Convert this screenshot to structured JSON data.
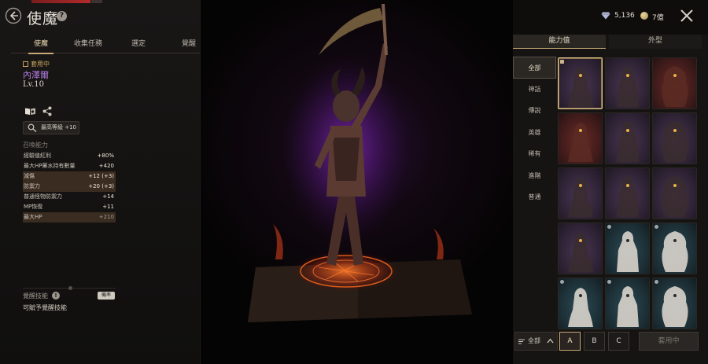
{
  "header": {
    "title": "使魔",
    "help": "?"
  },
  "tabs": [
    {
      "label": "使魔",
      "active": true
    },
    {
      "label": "收集任務",
      "active": false
    },
    {
      "label": "選定",
      "active": false
    },
    {
      "label": "覺醒",
      "active": false
    }
  ],
  "familiar": {
    "status_badge": "套用中",
    "name": "內澤爾",
    "level": "Lv.10",
    "max_level_button": "最高等級 +10",
    "summon_effect_label": "召喚能力",
    "stats": [
      {
        "label": "經驗值紅利",
        "value": "+80%",
        "highlight": false
      },
      {
        "label": "最大HP藥水持有數量",
        "value": "+420",
        "highlight": false
      },
      {
        "label": "減傷",
        "value": "+12 (+3)",
        "highlight": true
      },
      {
        "label": "防禦力",
        "value": "+20 (+3)",
        "highlight": true
      },
      {
        "label": "普通怪物防禦力",
        "value": "+14",
        "highlight": false
      },
      {
        "label": "MP恢復",
        "value": "+11",
        "highlight": false
      },
      {
        "label": "最大HP",
        "value": "+210",
        "highlight": true
      }
    ],
    "awaken": {
      "label": "覺醒技能",
      "help": "!",
      "tag": "機率",
      "description": "可賦予覺醒技能"
    }
  },
  "currency": {
    "gems": "5,136",
    "coins": "7億"
  },
  "right_tabs": [
    {
      "label": "能力值",
      "active": true
    },
    {
      "label": "外型",
      "active": false
    }
  ],
  "filters": [
    {
      "label": "全部",
      "active": true
    },
    {
      "label": "神話",
      "active": false
    },
    {
      "label": "傳說",
      "active": false
    },
    {
      "label": "英雄",
      "active": false
    },
    {
      "label": "稀有",
      "active": false
    },
    {
      "label": "進階",
      "active": false
    },
    {
      "label": "普通",
      "active": false
    }
  ],
  "grid_cards": [
    {
      "name": "dark-knight",
      "tier": "purple",
      "selected": true,
      "mark": "square"
    },
    {
      "name": "vampire-lord",
      "tier": "purple",
      "selected": false,
      "mark": "none"
    },
    {
      "name": "flame-beast",
      "tier": "red",
      "selected": false,
      "mark": "none"
    },
    {
      "name": "fire-dragon",
      "tier": "red",
      "selected": false,
      "mark": "none"
    },
    {
      "name": "skull-demon",
      "tier": "purple",
      "selected": false,
      "mark": "none"
    },
    {
      "name": "white-tiger",
      "tier": "purple",
      "selected": false,
      "mark": "none"
    },
    {
      "name": "treant",
      "tier": "purple",
      "selected": false,
      "mark": "none"
    },
    {
      "name": "werewolf",
      "tier": "purple",
      "selected": false,
      "mark": "none"
    },
    {
      "name": "rock-beast",
      "tier": "purple",
      "selected": false,
      "mark": "none"
    },
    {
      "name": "thorn-treant",
      "tier": "purple",
      "selected": false,
      "mark": "none"
    },
    {
      "name": "fennec-spirit",
      "tier": "blue",
      "selected": false,
      "mark": "round"
    },
    {
      "name": "mushroom-bear",
      "tier": "blue",
      "selected": false,
      "mark": "round"
    },
    {
      "name": "big-ear-fox",
      "tier": "blue",
      "selected": false,
      "mark": "round"
    },
    {
      "name": "snowman",
      "tier": "blue",
      "selected": false,
      "mark": "round"
    },
    {
      "name": "white-rabbit",
      "tier": "blue",
      "selected": false,
      "mark": "round"
    }
  ],
  "bottom": {
    "sort_label": "全部",
    "presets": [
      {
        "label": "A",
        "active": true
      },
      {
        "label": "B",
        "active": false
      },
      {
        "label": "C",
        "active": false
      }
    ],
    "apply_label": "套用中"
  },
  "colors": {
    "accent_gold": "#c7a876",
    "name_purple": "#b77ee6",
    "stat_highlight": "#3a2c20"
  }
}
